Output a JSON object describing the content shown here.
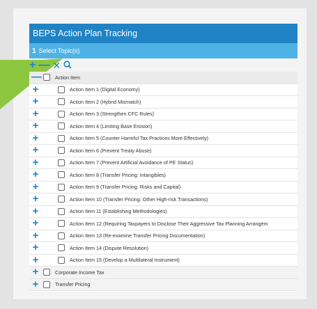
{
  "window": {
    "title": "BEPS Action Plan Tracking",
    "step_number": "1",
    "step_label": "Select Topic(s)"
  },
  "toolbar": {
    "expand": "+",
    "collapse": "—",
    "clear": "✕",
    "search_icon": "search-icon"
  },
  "tree": {
    "header_label": "Action Item",
    "items": [
      "Action Item 1 (Digital Economy)",
      "Action Item 2 (Hybrid Mismatch)",
      "Action Item 3 (Strengthen CFC Rules)",
      "Action Item 4 (Limiting Base Erosion)",
      "Action Item 5 (Counter Harmful Tax Practices More Effectively)",
      "Action Item 6 (Prevent Treaty Abuse)",
      "Action Item 7 (Prevent Artificial Avoidance of PE Status)",
      "Action Item 8 (Transfer Pricing: Intangibles)",
      "Action Item 9 (Transfer Pricing: Risks and Capital)",
      "Action Item 10 (Transfer Pricing: Other High-risk Transactions)",
      "Action Item 11 (Establishing Methodologies)",
      "Action Item 12 (Requiring Taxpayers to Disclose Their Aggressive Tax Planning Arrangem",
      "Action Item 13 (Re-examine Transfer Pricing Documentation)",
      "Action Item 14 (Dispute Resolution)",
      "Action Item 15 (Develop a Multilateral Instrument)"
    ],
    "parents": [
      "Corporate Income Tax",
      "Transfer Pricing"
    ]
  },
  "colors": {
    "accent": "#1f83c5",
    "step_bar": "#4fb2e5",
    "arrow": "#8dc63f"
  }
}
